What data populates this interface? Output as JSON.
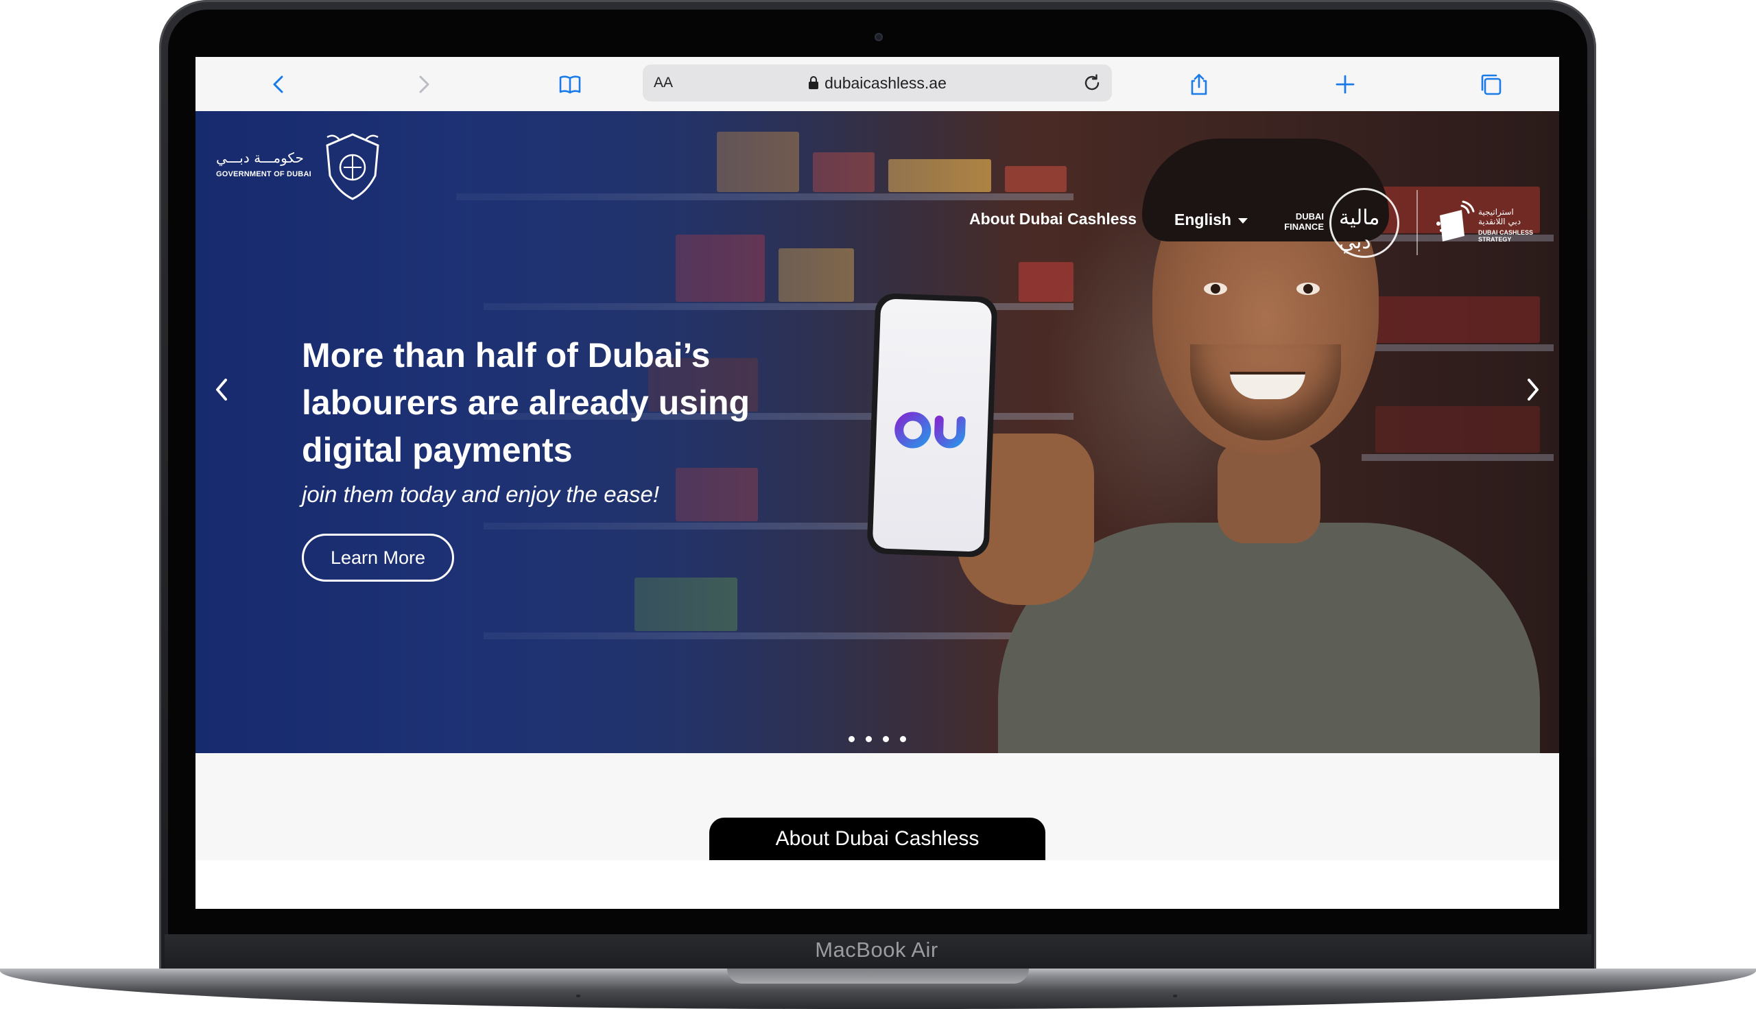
{
  "browser": {
    "url": "dubaicashless.ae",
    "text_size_label": "AA",
    "icons": [
      "back-icon",
      "forward-icon",
      "bookmarks-icon",
      "lock-icon",
      "reload-icon",
      "share-icon",
      "new-tab-icon",
      "tabs-icon"
    ]
  },
  "header": {
    "gov_logo_ar": "حكومـــة دبـــي",
    "gov_logo_en": "GOVERNMENT OF DUBAI",
    "nav_about": "About Dubai Cashless",
    "language": "English",
    "dubai_finance_en": "DUBAI\nFINANCE",
    "dubai_finance_ar": "مالية دبي",
    "strategy_ar": "استراتيجية\nدبي اللانقدية",
    "strategy_en": "DUBAI CASHLESS\nSTRATEGY"
  },
  "hero": {
    "headline": "More than half of Dubai’s\nlabourers are already using\ndigital payments",
    "subline": "join them today and enjoy the ease!",
    "cta": "Learn More",
    "slide_count": 4,
    "phone_brand": "du"
  },
  "about": {
    "tab_label": "About Dubai Cashless"
  },
  "device": {
    "label": "MacBook Air"
  },
  "colors": {
    "hero_blue": "#1a2e6b",
    "browser_blue": "#1a7ae8",
    "du_gradient_start": "#7b2fd1",
    "du_gradient_end": "#2f8fe8"
  }
}
